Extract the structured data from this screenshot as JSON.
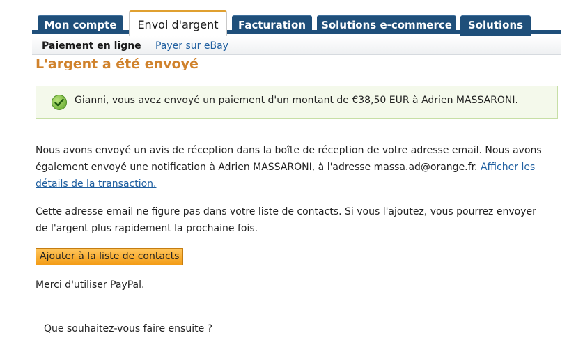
{
  "tabs": [
    {
      "label": "Mon compte",
      "active": false
    },
    {
      "label": "Envoi d'argent",
      "active": true
    },
    {
      "label": "Facturation",
      "active": false
    },
    {
      "label": "Solutions e-commerce",
      "active": false
    },
    {
      "label": "Solutions eBay",
      "active": false
    }
  ],
  "subnav": {
    "active": "Paiement en ligne",
    "link": "Payer sur eBay"
  },
  "page_title": "L'argent a été envoyé",
  "success": {
    "icon": "check-icon",
    "message": "Gianni, vous avez envoyé un paiement d'un montant de €38,50 EUR à Adrien MASSARONI."
  },
  "notice": {
    "text": "Nous avons envoyé un avis de réception dans la boîte de réception de votre adresse email. Nous avons également envoyé une notification à Adrien MASSARONI, à l'adresse massa.ad@orange.fr.",
    "link": "Afficher les détails de la transaction."
  },
  "contacts": {
    "text": "Cette adresse email ne figure pas dans votre liste de contacts. Si vous l'ajoutez, vous pourrez envoyer de l'argent plus rapidement la prochaine fois.",
    "button": "Ajouter à la liste de contacts"
  },
  "thanks": "Merci d'utiliser PayPal.",
  "next_prompt": "Que souhaitez-vous faire ensuite ?",
  "colors": {
    "tab_blue": "#1f4f7a",
    "title_orange": "#d0822c",
    "link_blue": "#1f5fa0",
    "button_orange": "#f39c16",
    "success_bg": "#f4f9eb"
  }
}
